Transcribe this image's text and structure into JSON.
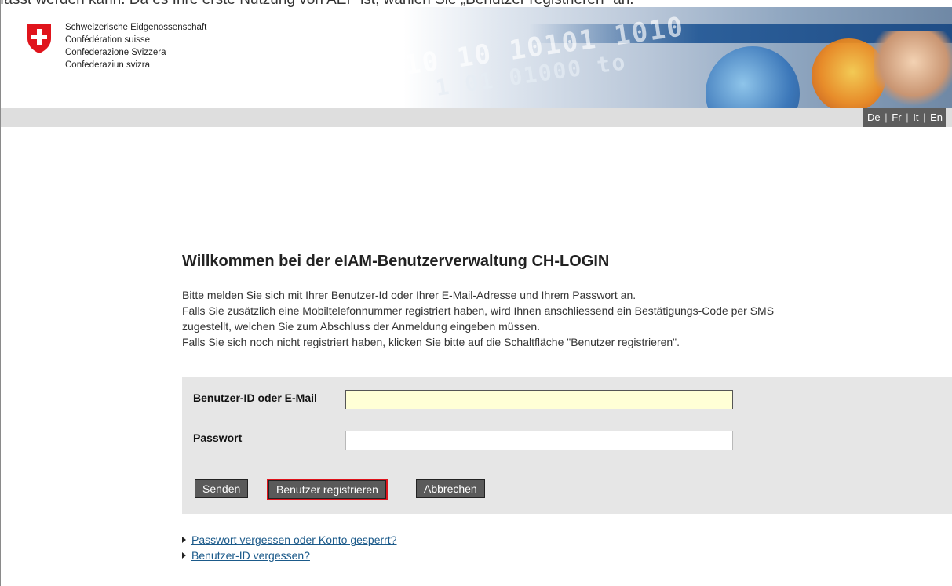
{
  "caption": "fasst werden kann. Da es Ihre erste Nutzung von AEP ist, wählen Sie „Benutzer registrieren“ an.",
  "header": {
    "fed_names": [
      "Schweizerische Eidgenossenschaft",
      "Confédération suisse",
      "Confederazione Svizzera",
      "Confederaziun svizra"
    ],
    "banner_digits": "10 10 10101 1010",
    "banner_digits2": "1 01 01000 to"
  },
  "lang": {
    "de": "De",
    "fr": "Fr",
    "it": "It",
    "en": "En",
    "sep": "|"
  },
  "main": {
    "title": "Willkommen bei der eIAM-Benutzerverwaltung CH-LOGIN",
    "intro": [
      "Bitte melden Sie sich mit Ihrer Benutzer-Id oder Ihrer E-Mail-Adresse und Ihrem Passwort an.",
      "Falls Sie zusätzlich eine Mobiltelefonnummer registriert haben, wird Ihnen anschliessend ein Bestätigungs-Code per SMS",
      "zugestellt, welchen Sie zum Abschluss der Anmeldung eingeben müssen.",
      "Falls Sie sich noch nicht registriert haben, klicken Sie bitte auf die Schaltfläche \"Benutzer registrieren\"."
    ]
  },
  "form": {
    "user_label": "Benutzer-ID oder E-Mail",
    "user_value": "",
    "password_label": "Passwort",
    "password_value": "",
    "send_label": "Senden",
    "register_label": "Benutzer registrieren",
    "cancel_label": "Abbrechen"
  },
  "links": {
    "forgot_password": "Passwort vergessen oder Konto gesperrt?",
    "forgot_user": "Benutzer-ID vergessen?"
  },
  "colors": {
    "crest_red": "#e0141c",
    "button_gray": "#5a5a5a",
    "highlight_red": "#e0141c",
    "link_blue": "#1b5a8a"
  }
}
